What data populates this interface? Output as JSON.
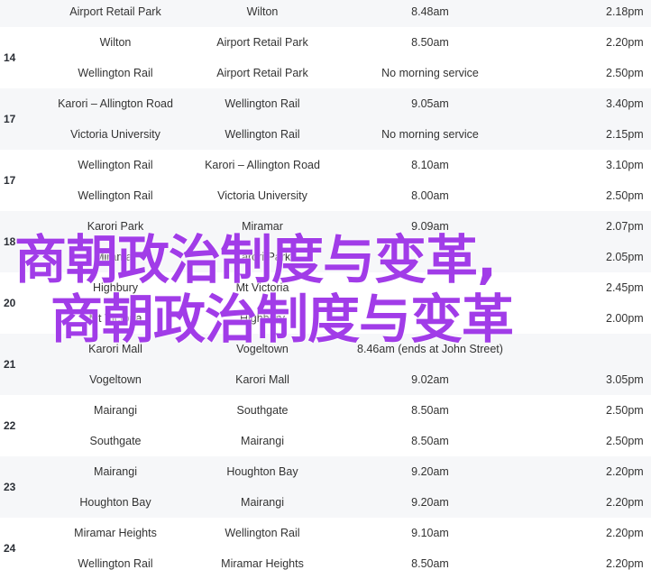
{
  "table": {
    "groups": [
      {
        "route": "",
        "rows": [
          {
            "from": "Airport Retail Park",
            "to": "Wilton",
            "first": "8.48am",
            "last": "2.18pm"
          }
        ]
      },
      {
        "route": "14",
        "rows": [
          {
            "from": "Wilton",
            "to": "Airport Retail Park",
            "first": "8.50am",
            "last": "2.20pm"
          },
          {
            "from": "Wellington Rail",
            "to": "Airport Retail Park",
            "first": "No morning service",
            "last": "2.50pm"
          }
        ]
      },
      {
        "route": "17",
        "rows": [
          {
            "from": "Karori – Allington Road",
            "to": "Wellington Rail",
            "first": "9.05am",
            "last": "3.40pm"
          },
          {
            "from": "Victoria University",
            "to": "Wellington Rail",
            "first": "No morning service",
            "last": "2.15pm"
          }
        ]
      },
      {
        "route": "17",
        "rows": [
          {
            "from": "Wellington Rail",
            "to": "Karori – Allington Road",
            "first": "8.10am",
            "last": "3.10pm"
          },
          {
            "from": "Wellington Rail",
            "to": "Victoria University",
            "first": "8.00am",
            "last": "2.50pm"
          }
        ]
      },
      {
        "route": "18",
        "rows": [
          {
            "from": "Karori Park",
            "to": "Miramar",
            "first": "9.09am",
            "last": "2.07pm"
          },
          {
            "from": "Miramar",
            "to": "Karori Park",
            "first": "",
            "last": "2.05pm"
          }
        ]
      },
      {
        "route": "20",
        "rows": [
          {
            "from": "Highbury",
            "to": "Mt Victoria",
            "first": "",
            "last": "2.45pm"
          },
          {
            "from": "Mt Victoria",
            "to": "Highbury",
            "first": "",
            "last": "2.00pm"
          }
        ]
      },
      {
        "route": "21",
        "rows": [
          {
            "from": "Karori Mall",
            "to": "Vogeltown",
            "first": "8.46am (ends at John Street)",
            "last": ""
          },
          {
            "from": "Vogeltown",
            "to": "Karori Mall",
            "first": "9.02am",
            "last": "3.05pm"
          }
        ]
      },
      {
        "route": "22",
        "rows": [
          {
            "from": "Mairangi",
            "to": "Southgate",
            "first": "8.50am",
            "last": "2.50pm"
          },
          {
            "from": "Southgate",
            "to": "Mairangi",
            "first": "8.50am",
            "last": "2.50pm"
          }
        ]
      },
      {
        "route": "23",
        "rows": [
          {
            "from": "Mairangi",
            "to": "Houghton Bay",
            "first": "9.20am",
            "last": "2.20pm"
          },
          {
            "from": "Houghton Bay",
            "to": "Mairangi",
            "first": "9.20am",
            "last": "2.20pm"
          }
        ]
      },
      {
        "route": "24",
        "rows": [
          {
            "from": "Miramar Heights",
            "to": "Wellington Rail",
            "first": "9.10am",
            "last": "2.20pm"
          },
          {
            "from": "Wellington Rail",
            "to": "Miramar Heights",
            "first": "8.50am",
            "last": "2.20pm"
          }
        ]
      }
    ]
  },
  "watermark": {
    "line1": "商朝政治制度与变革,",
    "line2": "商朝政治制度与变革",
    "color": "#a13ce8"
  },
  "colors": {
    "row_shade": "#f6f7f9",
    "text": "#333333"
  }
}
